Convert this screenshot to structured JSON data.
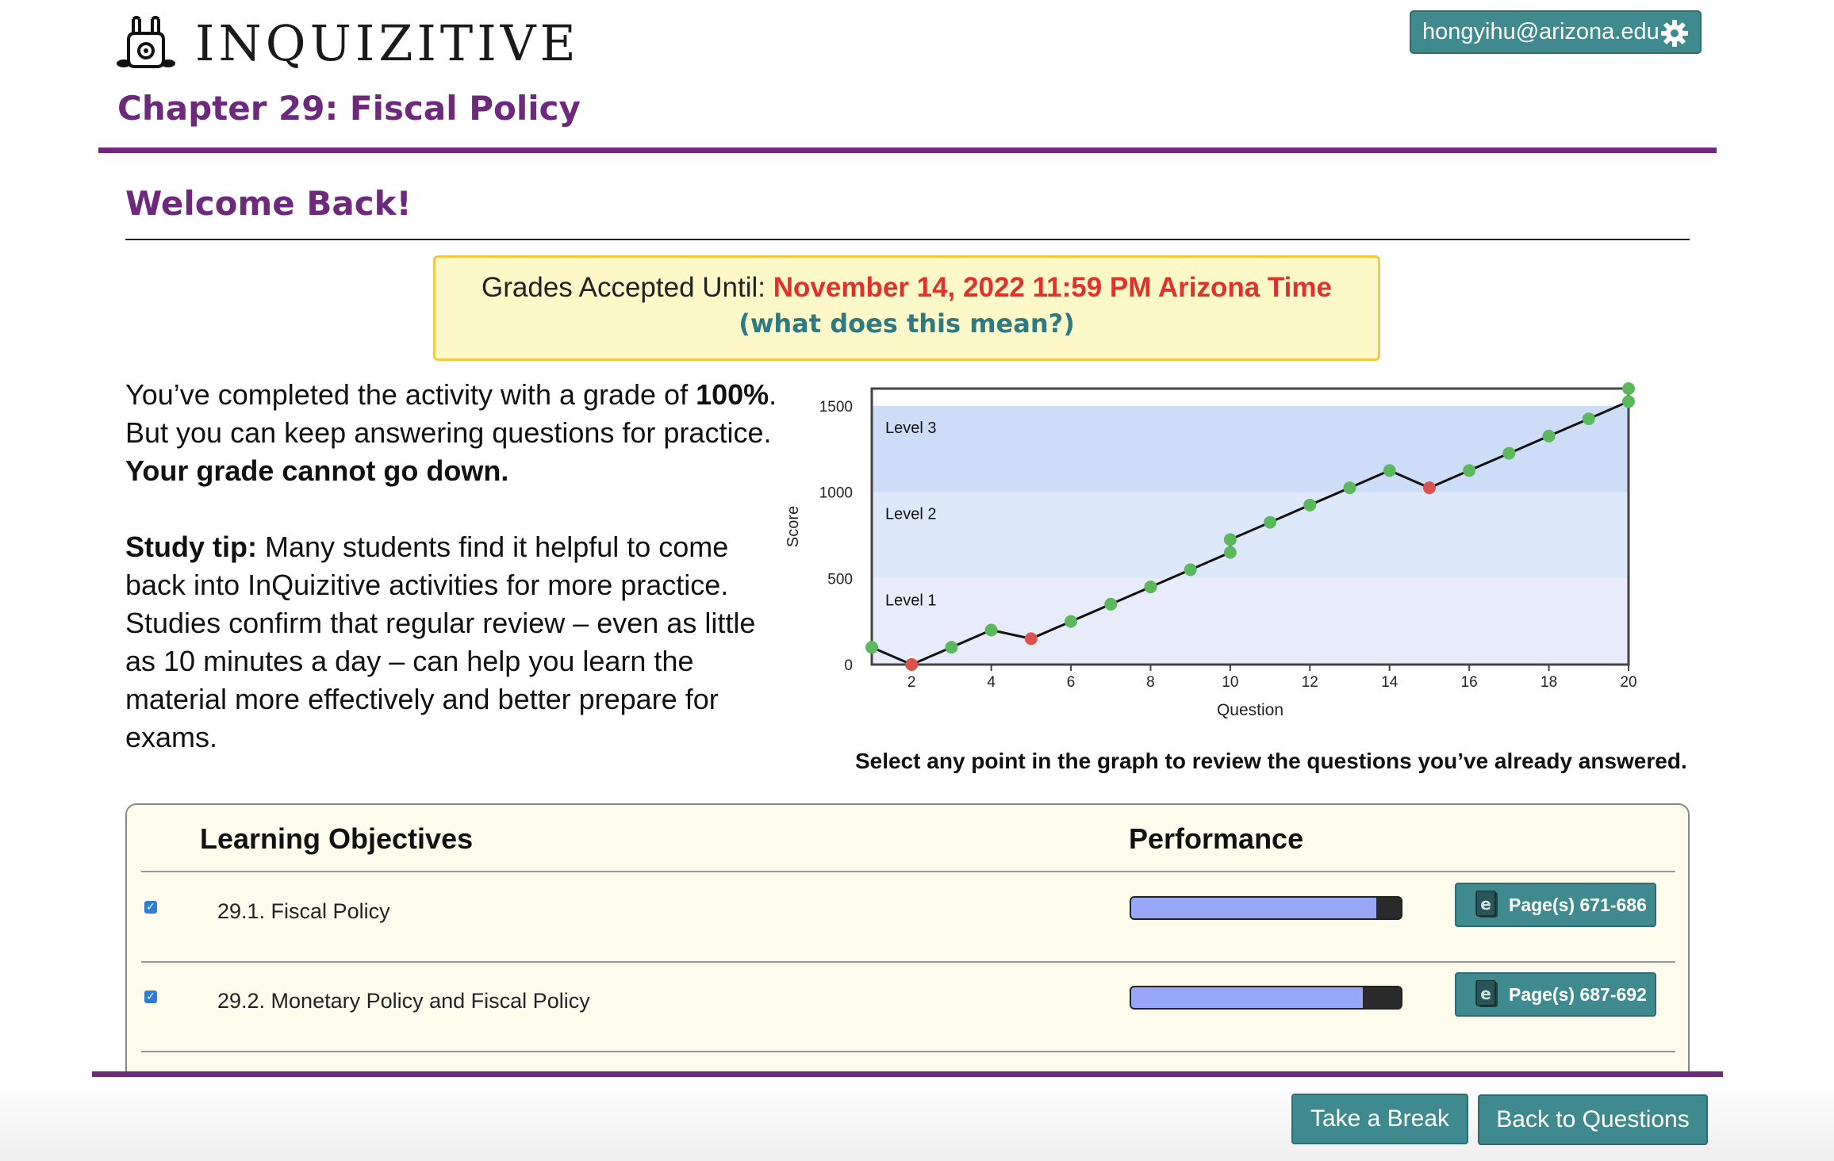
{
  "header": {
    "logo_text": "INQUIZITIVE",
    "user_email": "hongyihu@arizona.edu",
    "chapter_title": "Chapter 29: Fiscal Policy"
  },
  "welcome": {
    "title": "Welcome Back!",
    "deadline_prefix": "Grades Accepted Until: ",
    "deadline_date": "November 14, 2022 11:59 PM Arizona Time",
    "deadline_help": "(what does this mean?)"
  },
  "intro": {
    "line1_pre": "You’ve completed the activity with a grade of ",
    "grade": "100%",
    "line1_post": ".",
    "line2": "But you can keep answering questions for practice.",
    "line3": "Your grade cannot go down.",
    "tip_label": "Study tip:",
    "tip_text": " Many students find it helpful to come back into InQuizitive activities for more practice. Studies confirm that regular review – even as little as 10 minutes a day – can help you learn the material more effectively and better prepare for exams."
  },
  "chart_data": {
    "type": "line",
    "xlabel": "Question",
    "ylabel": "Score",
    "xlim": [
      1,
      20
    ],
    "ylim": [
      0,
      1600
    ],
    "x_ticks": [
      2,
      4,
      6,
      8,
      10,
      12,
      14,
      16,
      18,
      20
    ],
    "y_ticks": [
      0,
      500,
      1000,
      1500
    ],
    "bands": [
      {
        "label": "Level 1",
        "from": 0,
        "to": 500,
        "color": "#e8ebfa"
      },
      {
        "label": "Level 2",
        "from": 500,
        "to": 1000,
        "color": "#dde8fb"
      },
      {
        "label": "Level 3",
        "from": 1000,
        "to": 1500,
        "color": "#cdddf8"
      }
    ],
    "points": [
      {
        "x": 1,
        "y": 100,
        "correct": true
      },
      {
        "x": 2,
        "y": 0,
        "correct": false
      },
      {
        "x": 3,
        "y": 100,
        "correct": true
      },
      {
        "x": 4,
        "y": 200,
        "correct": true
      },
      {
        "x": 5,
        "y": 150,
        "correct": false
      },
      {
        "x": 6,
        "y": 250,
        "correct": true
      },
      {
        "x": 7,
        "y": 350,
        "correct": true
      },
      {
        "x": 8,
        "y": 450,
        "correct": true
      },
      {
        "x": 9,
        "y": 550,
        "correct": true
      },
      {
        "x": 10,
        "y": 650,
        "correct": true
      },
      {
        "x": 10,
        "y": 725,
        "correct": true
      },
      {
        "x": 11,
        "y": 825,
        "correct": true
      },
      {
        "x": 12,
        "y": 925,
        "correct": true
      },
      {
        "x": 13,
        "y": 1025,
        "correct": true
      },
      {
        "x": 14,
        "y": 1125,
        "correct": true
      },
      {
        "x": 15,
        "y": 1025,
        "correct": false
      },
      {
        "x": 16,
        "y": 1125,
        "correct": true
      },
      {
        "x": 17,
        "y": 1225,
        "correct": true
      },
      {
        "x": 18,
        "y": 1325,
        "correct": true
      },
      {
        "x": 19,
        "y": 1425,
        "correct": true
      },
      {
        "x": 20,
        "y": 1525,
        "correct": true
      },
      {
        "x": 20,
        "y": 1600,
        "correct": true
      }
    ],
    "colors": {
      "correct": "#5cb85c",
      "incorrect": "#d9534f",
      "line": "#111111"
    }
  },
  "chart_caption": "Select any point in the graph to review the questions you’ve already answered.",
  "objectives": {
    "col_objectives": "Learning Objectives",
    "col_performance": "Performance",
    "rows": [
      {
        "label": "29.1. Fiscal Policy",
        "performance": 0.91,
        "pages": "Page(s) 671-686",
        "checked": true
      },
      {
        "label": "29.2. Monetary Policy and Fiscal Policy",
        "performance": 0.86,
        "pages": "Page(s) 687-692",
        "checked": true
      }
    ]
  },
  "footer": {
    "take_break": "Take a Break",
    "back_to_questions": "Back to Questions"
  },
  "colors": {
    "brand_purple": "#6d2a7c",
    "teal_button": "#3f8a8f",
    "deadline_red": "#e0312a"
  }
}
